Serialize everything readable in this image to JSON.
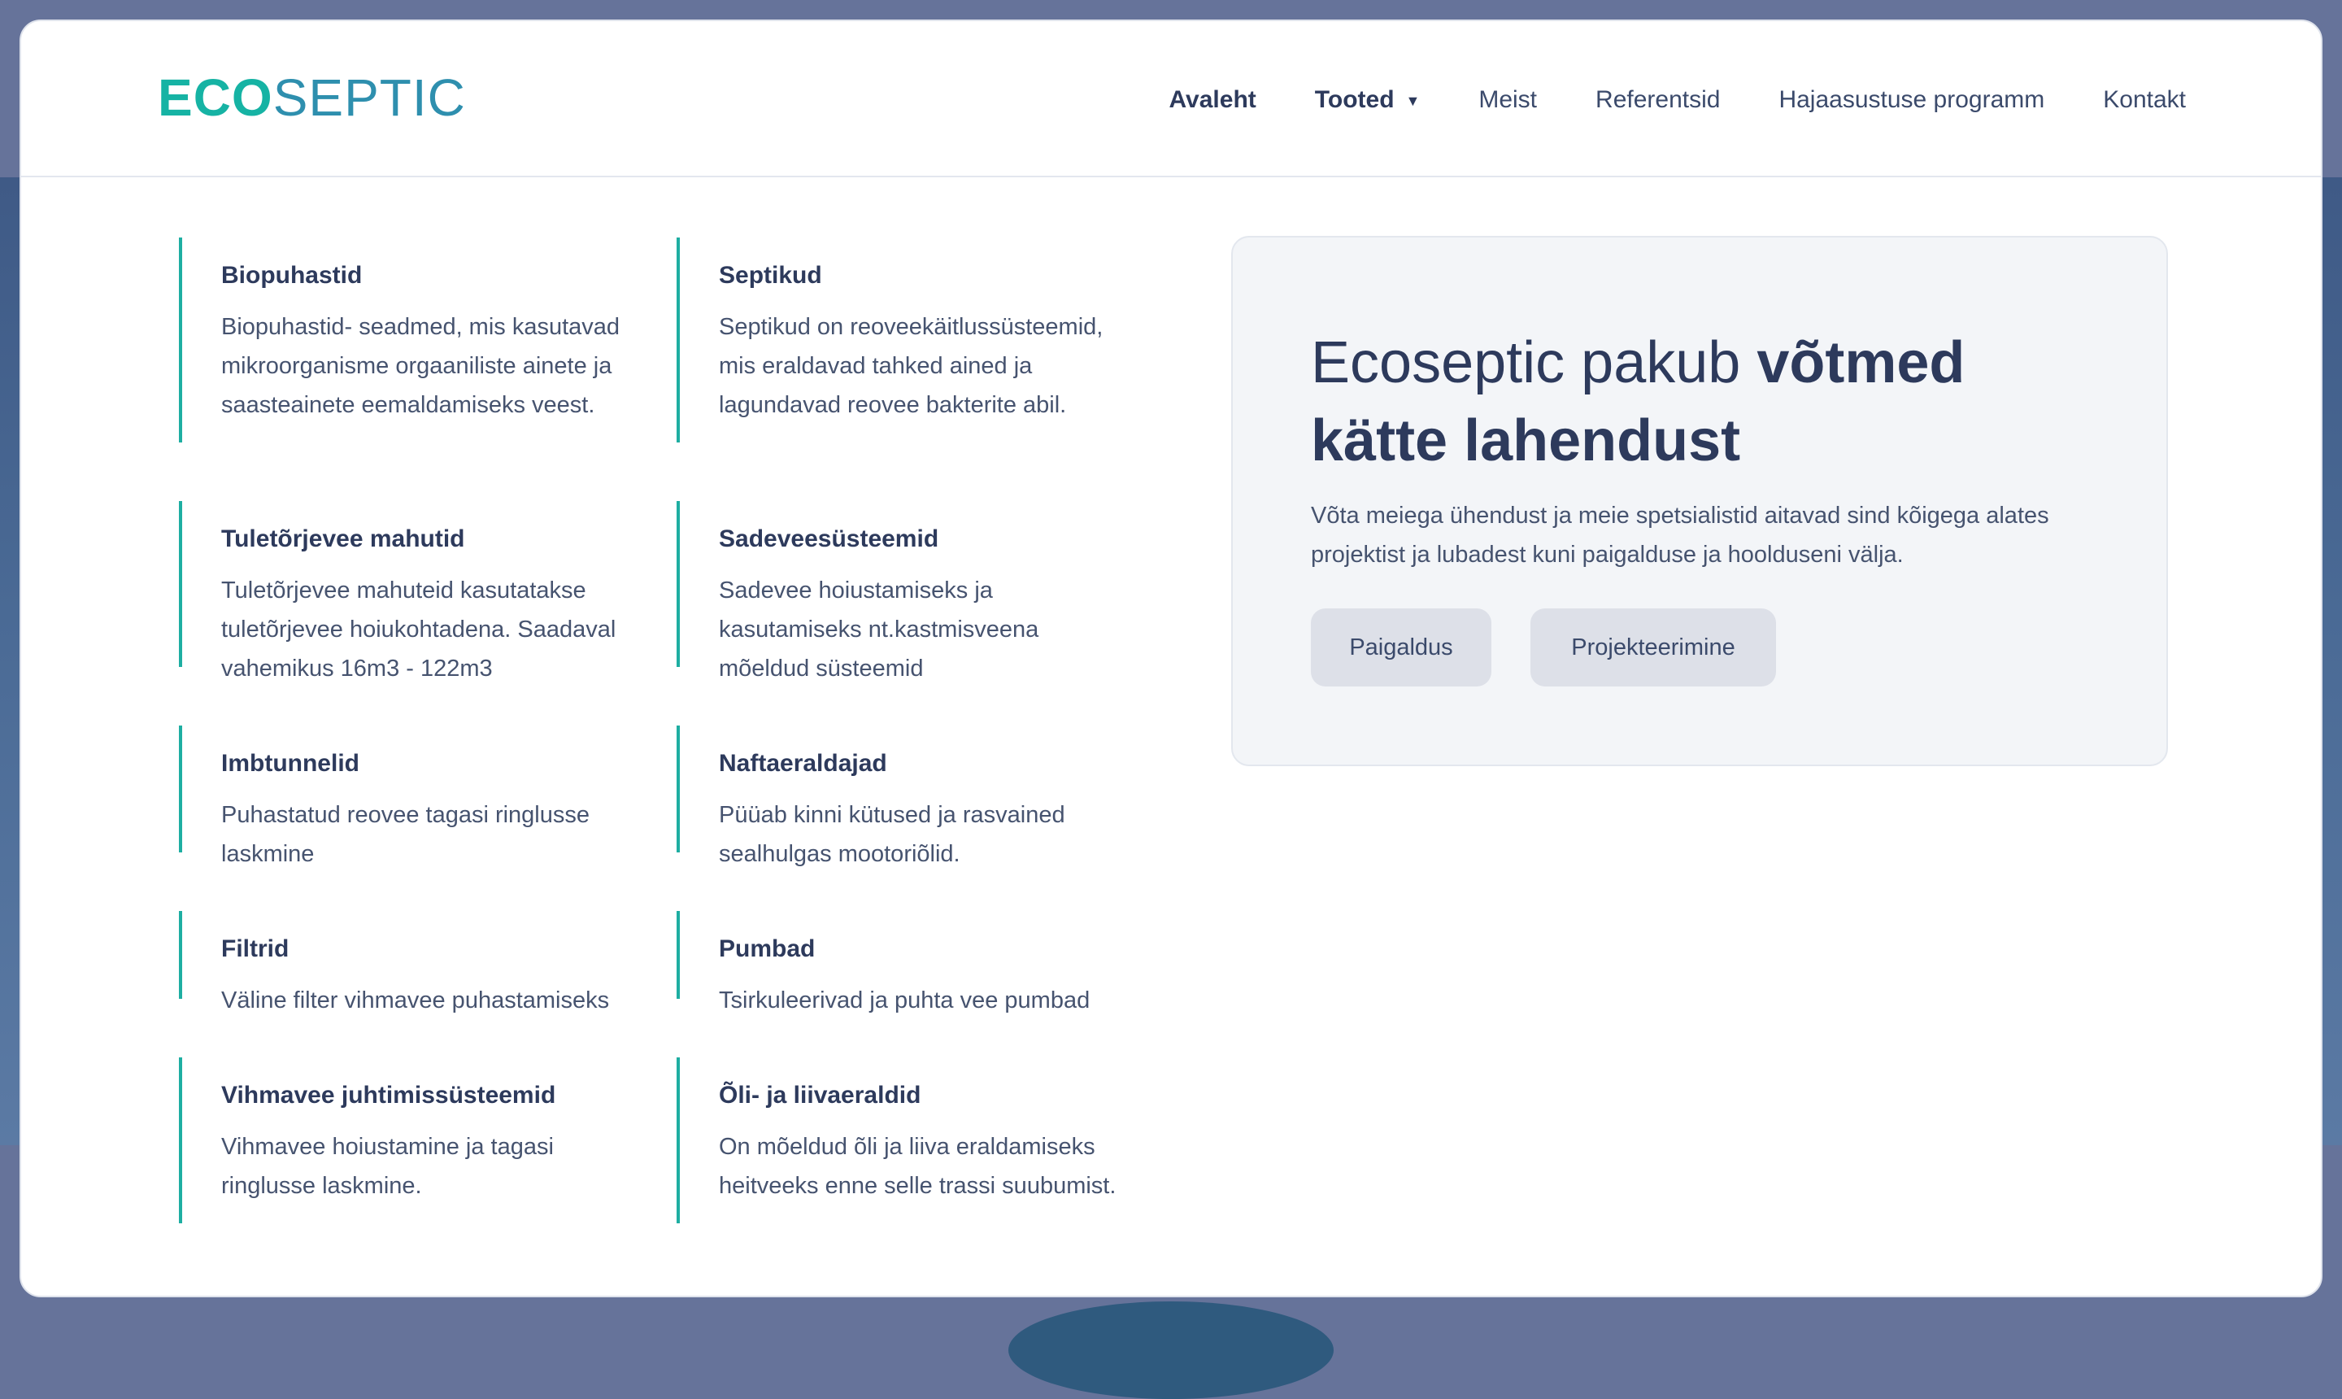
{
  "brand": {
    "logo_part1": "ECO",
    "logo_part2": "SEPTIC",
    "logo_color1": "#16b3a4",
    "logo_color2": "#2e8fae"
  },
  "nav": {
    "items": [
      {
        "label": "Avaleht"
      },
      {
        "label": "Tooted",
        "icon": "caret-down-icon"
      },
      {
        "label": "Meist"
      },
      {
        "label": "Referentsid"
      },
      {
        "label": "Hajaasustuse programm"
      },
      {
        "label": "Kontakt"
      }
    ]
  },
  "categories": [
    {
      "title": "Biopuhastid",
      "desc": "Biopuhastid- seadmed, mis kasutavad mikroorganisme orgaaniliste ainete ja saasteainete eemaldamiseks veest."
    },
    {
      "title": "Septikud",
      "desc": "Septikud on reoveekäitlussüsteemid, mis eraldavad tahked ained ja lagundavad reovee bakterite abil."
    },
    {
      "title": "Tuletõrjevee mahutid",
      "desc": "Tuletõrjevee mahuteid kasutatakse tuletõrjevee hoiukohtadena. Saadaval vahemikus 16m3 - 122m3"
    },
    {
      "title": "Sadeveesüsteemid",
      "desc": "Sadevee hoiustamiseks ja kasutamiseks nt.kastmisveena mõeldud süsteemid"
    },
    {
      "title": "Imbtunnelid",
      "desc": "Puhastatud reovee tagasi ringlusse laskmine"
    },
    {
      "title": "Naftaeraldajad",
      "desc": "Püüab kinni kütused ja rasvained sealhulgas mootoriõlid."
    },
    {
      "title": "Filtrid",
      "desc": "Väline filter vihmavee puhastamiseks"
    },
    {
      "title": "Pumbad",
      "desc": "Tsirkuleerivad ja puhta vee pumbad"
    },
    {
      "title": "Vihmavee juhtimissüsteemid",
      "desc": "Vihmavee hoiustamine ja tagasi ringlusse laskmine."
    },
    {
      "title": "Õli- ja liivaeraldid",
      "desc": "On mõeldud õli ja liiva eraldamiseks heitveeks enne selle trassi suubumist."
    }
  ],
  "promo": {
    "heading_plain": "Ecoseptic pakub ",
    "heading_bold1": "võtmed",
    "heading_bold2": "kätte lahendust",
    "sub": "Võta meiega ühendust ja meie spetsialistid aitavad sind kõigega alates projektist ja lubadest kuni paigalduse ja hoolduseni välja.",
    "btn1": "Paigaldus",
    "btn2": "Projekteerimine"
  },
  "colors": {
    "accent": "#1eaea2",
    "text_dark": "#2d3a5c",
    "text_body": "#46536f",
    "promo_bg": "#f3f5f8",
    "button_bg": "#dde0e8"
  }
}
